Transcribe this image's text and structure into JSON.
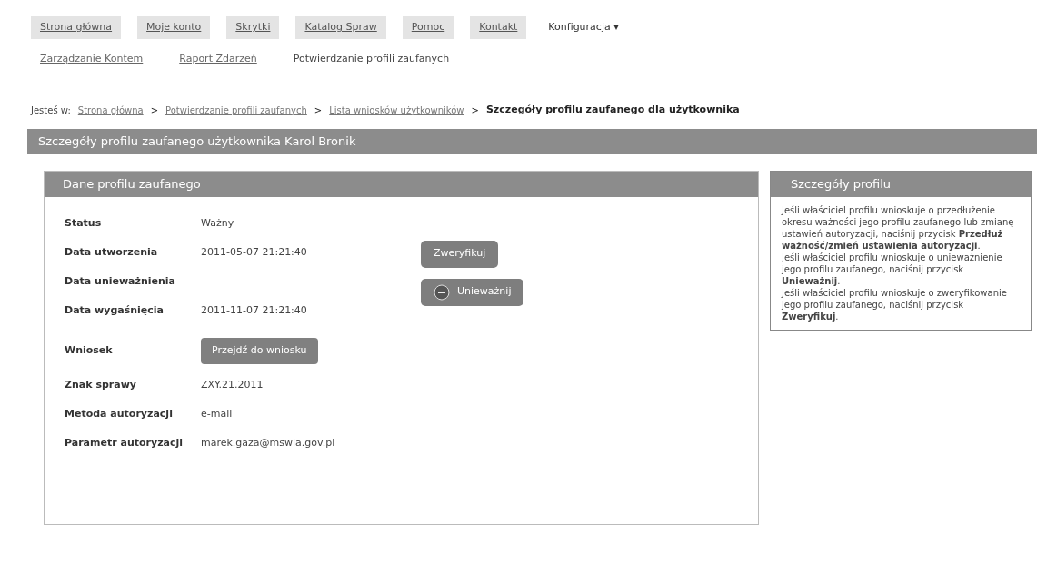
{
  "nav": {
    "items": [
      {
        "label": "Strona główna",
        "selected": false
      },
      {
        "label": "Moje konto",
        "selected": false
      },
      {
        "label": "Skrytki",
        "selected": false
      },
      {
        "label": "Katalog Spraw",
        "selected": false
      },
      {
        "label": "Pomoc",
        "selected": false
      },
      {
        "label": "Kontakt",
        "selected": false
      },
      {
        "label": "Konfiguracja ▾",
        "selected": true
      }
    ],
    "subitems": [
      {
        "label": "Zarządzanie Kontem",
        "selected": false
      },
      {
        "label": "Raport Zdarzeń",
        "selected": false
      },
      {
        "label": "Potwierdzanie profili zaufanych",
        "selected": true
      }
    ]
  },
  "breadcrumb": {
    "prefix": "Jesteś w:",
    "links": [
      "Strona główna",
      "Potwierdzanie profili zaufanych",
      "Lista wniosków użytkowników"
    ],
    "separator": ">",
    "current": "Szczegóły profilu zaufanego dla użytkownika"
  },
  "page_title": "Szczegóły profilu zaufanego użytkownika Karol Bronik",
  "profile_panel": {
    "title": "Dane profilu zaufanego",
    "rows": [
      {
        "kind": "text",
        "label": "Status",
        "value": "Ważny"
      },
      {
        "kind": "text",
        "label": "Data utworzenia",
        "value": "2011-05-07 21:21:40"
      },
      {
        "kind": "text",
        "label": "Data unieważnienia"
      },
      {
        "kind": "text",
        "label": "Data wygaśnięcia",
        "value": "2011-11-07 21:21:40"
      },
      {
        "kind": "button",
        "label": "Wniosek",
        "value": "Przejdź do wniosku"
      },
      {
        "kind": "text",
        "label": "Znak sprawy",
        "value": "ZXY.21.2011"
      },
      {
        "kind": "text",
        "label": "Metoda autoryzacji",
        "value": "e-mail"
      },
      {
        "kind": "text",
        "label": "Parametr autoryzacji",
        "value": "marek.gaza@mswia.gov.pl"
      }
    ],
    "actions": [
      {
        "label": "Zweryfikuj",
        "icon": false
      },
      {
        "label": "Unieważnij",
        "icon": true
      }
    ]
  },
  "help_panel": {
    "title": "Szczegóły profilu",
    "paragraphs": [
      "Jeśli właściciel profilu wnioskuje o przedłużenie okresu ważności jego profilu zaufanego lub zmianę ustawień autoryzacji, naciśnij przycisk **Przedłuż ważność/zmień ustawienia autoryzacji**.",
      "Jeśli właściciel profilu wnioskuje o unieważnienie jego profilu zaufanego, naciśnij przycisk **Unieważnij**.",
      "Jeśli właściciel profilu wnioskuje o zweryfikowanie jego profilu zaufanego, naciśnij przycisk **Zweryfikuj**."
    ]
  }
}
